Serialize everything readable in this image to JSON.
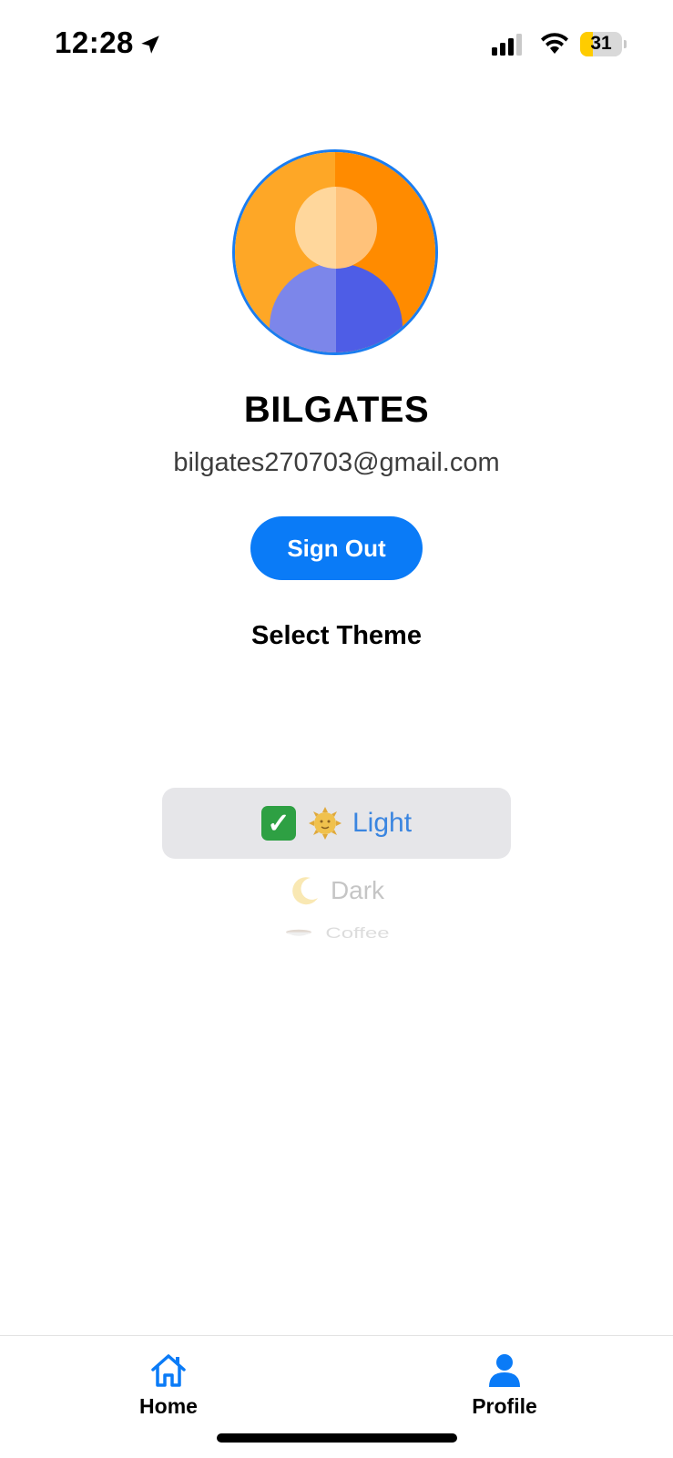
{
  "status_bar": {
    "time": "12:28",
    "battery_level": "31",
    "icons": [
      "location-arrow-icon",
      "cellular-signal-icon",
      "wifi-icon",
      "battery-icon"
    ]
  },
  "profile": {
    "name": "BILGATES",
    "email": "bilgates270703@gmail.com",
    "avatar_icon": "user-avatar-icon",
    "sign_out_label": "Sign Out"
  },
  "theme": {
    "title": "Select Theme",
    "selected": {
      "check": "✓",
      "label": "Light",
      "icon": "sun-face-icon"
    },
    "options": [
      {
        "label": "Dark",
        "icon": "crescent-moon-icon"
      },
      {
        "label": "Coffee",
        "icon": "coffee-cup-icon"
      }
    ]
  },
  "tab_bar": {
    "tabs": [
      {
        "label": "Home",
        "icon": "home-icon",
        "active": false
      },
      {
        "label": "Profile",
        "icon": "person-icon",
        "active": true
      }
    ]
  },
  "colors": {
    "accent": "#0a7bf7",
    "check": "#2ea043",
    "avatar_orange_light": "#fea726",
    "avatar_orange_dark": "#ff8b00",
    "avatar_body_light": "#7c86ea",
    "avatar_body_dark": "#4e5de6",
    "picker_highlight": "#e6e6e9"
  }
}
